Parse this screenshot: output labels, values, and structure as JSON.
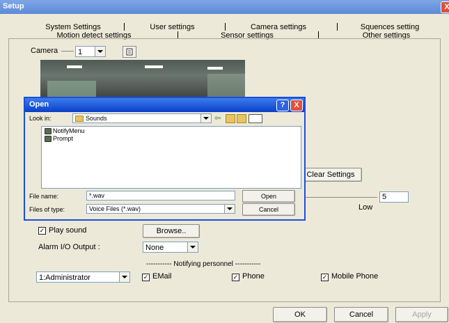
{
  "window": {
    "title": "Setup",
    "close_label": "X"
  },
  "tabs_row1": [
    "System Settings",
    "User settings",
    "Camera settings",
    "Squences setting"
  ],
  "tabs_row2": [
    "Motion detect settings",
    "Sensor settings",
    "Other settings"
  ],
  "camera": {
    "label": "Camera",
    "value": "1"
  },
  "clear_settings_label": "Clear Settings",
  "sensitivity": {
    "value": "5",
    "low_label": "Low"
  },
  "play_sound": {
    "label": "Play sound",
    "checked": true,
    "browse_label": "Browse.."
  },
  "alarm_output": {
    "label": "Alarm I/O Output :",
    "value": "None"
  },
  "notifying": {
    "header": "----------- Notifying personnel -----------",
    "user_value": "1:Administrator",
    "email_label": "EMail",
    "phone_label": "Phone",
    "mobile_label": "Mobile Phone"
  },
  "footer": {
    "ok_label": "OK",
    "cancel_label": "Cancel",
    "apply_label": "Apply"
  },
  "open_dialog": {
    "title": "Open",
    "help_label": "?",
    "close_label": "X",
    "look_in_label": "Look in:",
    "look_in_value": "Sounds",
    "files": [
      "NotifyMenu",
      "Prompt"
    ],
    "file_name_label": "File name:",
    "file_name_value": "*.wav",
    "file_type_label": "Files of type:",
    "file_type_value": "Voice Files (*.wav)",
    "open_label": "Open",
    "cancel_label": "Cancel"
  }
}
